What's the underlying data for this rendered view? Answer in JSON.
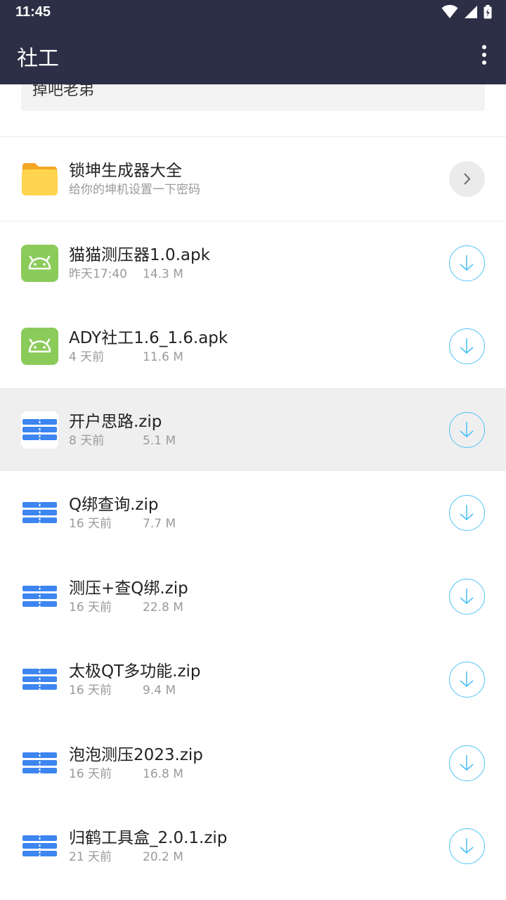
{
  "status": {
    "time": "11:45"
  },
  "appbar": {
    "title": "社工"
  },
  "note": {
    "text": "掉吧老弟"
  },
  "items": [
    {
      "name": "锁坤生成器大全",
      "subtitle": "给你的坤机设置一下密码",
      "type": "folder",
      "action": "open"
    },
    {
      "name": "猫猫测压器1.0.apk",
      "age": "昨天17:40",
      "size": "14.3 M",
      "type": "apk",
      "action": "download"
    },
    {
      "name": "ADY社工1.6_1.6.apk",
      "age": "4 天前",
      "size": "11.6 M",
      "type": "apk",
      "action": "download"
    },
    {
      "name": "开户思路.zip",
      "age": "8 天前",
      "size": "5.1 M",
      "type": "zip",
      "action": "download"
    },
    {
      "name": "Q绑查询.zip",
      "age": "16 天前",
      "size": "7.7 M",
      "type": "zip",
      "action": "download"
    },
    {
      "name": "测压+查Q绑.zip",
      "age": "16 天前",
      "size": "22.8 M",
      "type": "zip",
      "action": "download"
    },
    {
      "name": "太极QT多功能.zip",
      "age": "16 天前",
      "size": "9.4 M",
      "type": "zip",
      "action": "download"
    },
    {
      "name": "泡泡测压2023.zip",
      "age": "16 天前",
      "size": "16.8 M",
      "type": "zip",
      "action": "download"
    },
    {
      "name": "归鹤工具盒_2.0.1.zip",
      "age": "21 天前",
      "size": "20.2 M",
      "type": "zip",
      "action": "download"
    }
  ],
  "colors": {
    "header": "#2c2f45",
    "accent": "#4fc3f7",
    "folder": "#ffd54f",
    "android": "#8bcb5a",
    "zip": "#3d85f0"
  }
}
